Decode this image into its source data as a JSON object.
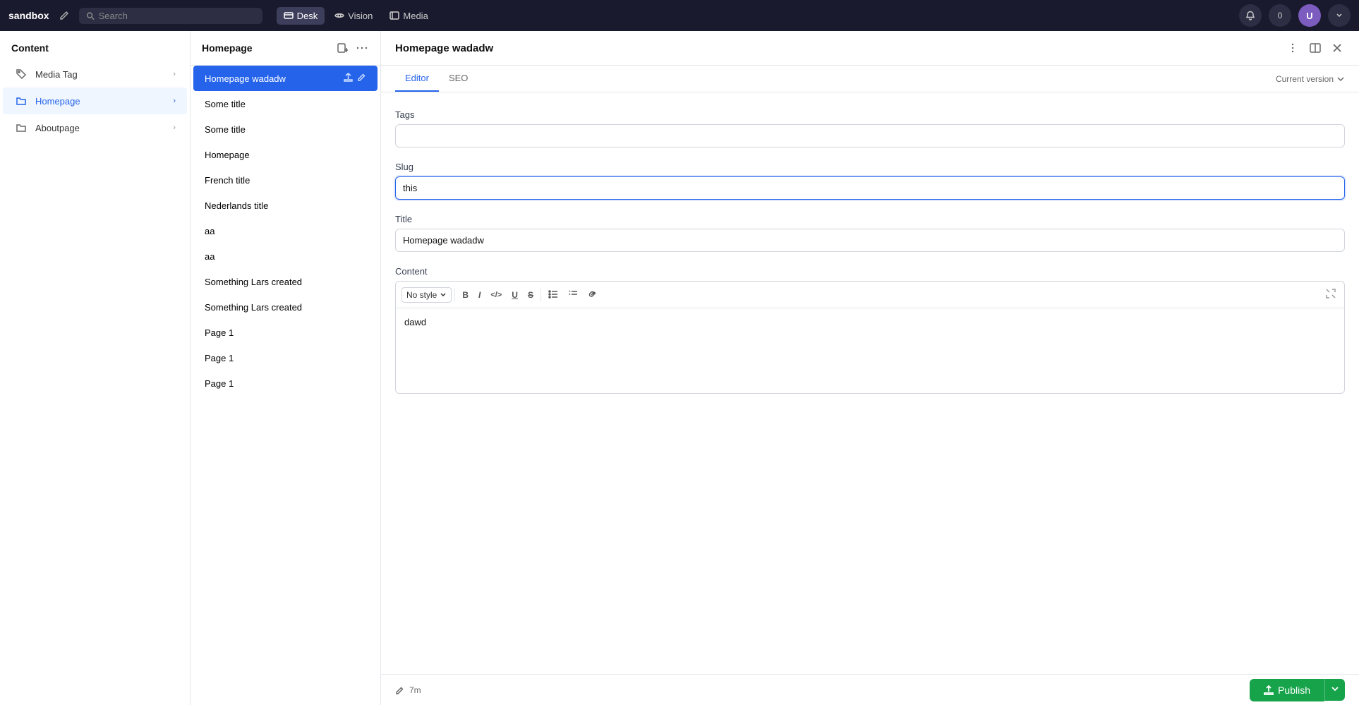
{
  "topbar": {
    "brand": "sandbox",
    "search_placeholder": "Search",
    "nav_items": [
      {
        "id": "desk",
        "label": "Desk",
        "icon": "desk-icon",
        "active": true
      },
      {
        "id": "vision",
        "label": "Vision",
        "icon": "eye-icon",
        "active": false
      },
      {
        "id": "media",
        "label": "Media",
        "icon": "media-icon",
        "active": false
      }
    ],
    "notification_count": "0"
  },
  "sidebar": {
    "header": "Content",
    "items": [
      {
        "id": "media-tag",
        "label": "Media Tag",
        "icon": "tag-icon"
      },
      {
        "id": "homepage",
        "label": "Homepage",
        "icon": "folder-icon",
        "active": true
      },
      {
        "id": "aboutpage",
        "label": "Aboutpage",
        "icon": "folder-icon"
      }
    ]
  },
  "mid_panel": {
    "title": "Homepage",
    "items": [
      {
        "id": "homepage-wadadw",
        "label": "Homepage wadadw",
        "active": true
      },
      {
        "id": "some-title-1",
        "label": "Some title"
      },
      {
        "id": "some-title-2",
        "label": "Some title"
      },
      {
        "id": "homepage",
        "label": "Homepage"
      },
      {
        "id": "french-title",
        "label": "French title"
      },
      {
        "id": "nederlands-title",
        "label": "Nederlands title"
      },
      {
        "id": "aa-1",
        "label": "aa"
      },
      {
        "id": "aa-2",
        "label": "aa"
      },
      {
        "id": "lars-1",
        "label": "Something Lars created"
      },
      {
        "id": "lars-2",
        "label": "Something Lars created"
      },
      {
        "id": "page1-1",
        "label": "Page 1"
      },
      {
        "id": "page1-2",
        "label": "Page 1"
      },
      {
        "id": "page1-3",
        "label": "Page 1"
      }
    ]
  },
  "right_panel": {
    "title": "Homepage wadadw",
    "tabs": [
      {
        "id": "editor",
        "label": "Editor",
        "active": true
      },
      {
        "id": "seo",
        "label": "SEO",
        "active": false
      }
    ],
    "version_label": "Current version",
    "fields": {
      "tags_label": "Tags",
      "tags_value": "",
      "tags_placeholder": "",
      "slug_label": "Slug",
      "slug_value": "this",
      "title_label": "Title",
      "title_value": "Homepage wadadw",
      "content_label": "Content",
      "content_value": "dawd",
      "toolbar": {
        "style_label": "No style",
        "buttons": [
          "B",
          "I",
          "</>",
          "U",
          "S"
        ]
      }
    }
  },
  "bottom_bar": {
    "time_label": "7m",
    "publish_label": "Publish"
  },
  "icons": {
    "tag": "🏷",
    "folder": "📁",
    "chevron_right": "›",
    "chevron_down": "⌄",
    "edit": "✎",
    "external": "↗",
    "more": "⋯",
    "upload": "↑",
    "expand": "⤢",
    "link": "🔗",
    "list_ul": "☰",
    "list_ol": "≡",
    "pencil": "✏",
    "eye": "👁",
    "media": "▤",
    "desk": "▦",
    "search": "🔍",
    "bold": "B",
    "italic": "I",
    "code": "</>",
    "underline": "U",
    "strikethrough": "S"
  }
}
